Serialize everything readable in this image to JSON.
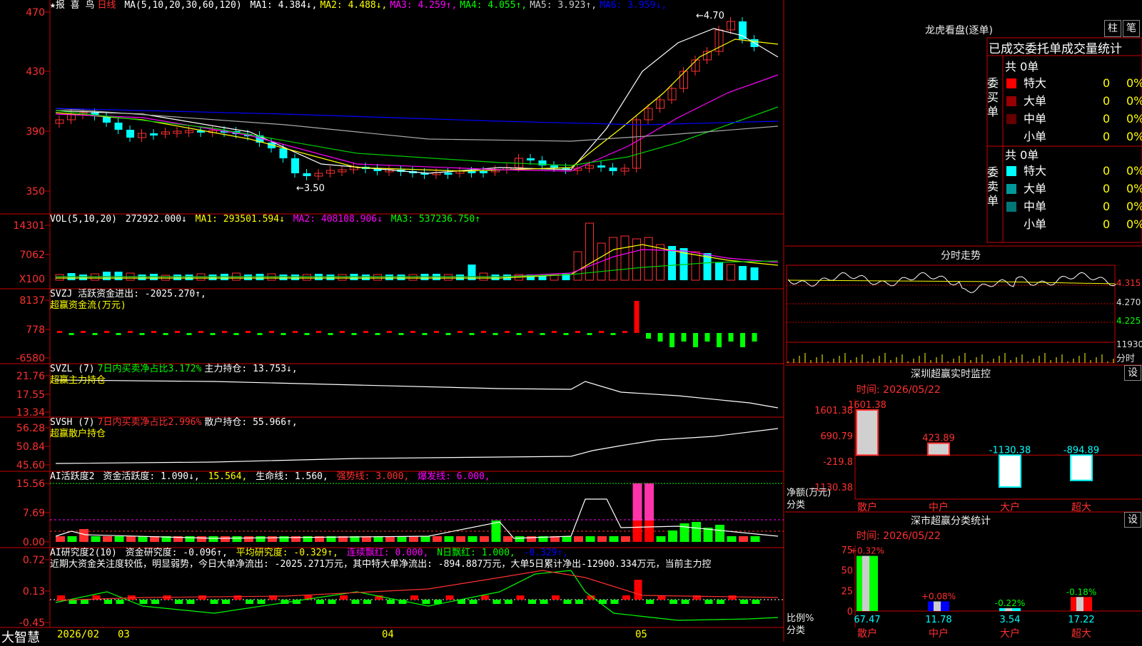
{
  "kline": {
    "title_star": "★报 喜 鸟",
    "period": "日线",
    "ma_params": "MA(5,10,20,30,60,120)",
    "ma": [
      {
        "label": "MA1:",
        "value": "4.384↓",
        "color": "#ffffff"
      },
      {
        "label": "MA2:",
        "value": "4.488↓",
        "color": "#ffff00"
      },
      {
        "label": "MA3:",
        "value": "4.259↑",
        "color": "#ff00ff"
      },
      {
        "label": "MA4:",
        "value": "4.055↑",
        "color": "#00ff00"
      },
      {
        "label": "MA5:",
        "value": "3.923↑",
        "color": "#cccccc"
      },
      {
        "label": "MA6:",
        "value": "3.959↓",
        "color": "#0000ff"
      }
    ],
    "high_marker": "4.70",
    "low_marker": "3.50",
    "y_ticks": [
      "470",
      "430",
      "390",
      "350"
    ]
  },
  "volume": {
    "header_params": "VOL(5,10,20)",
    "value": "272922.000↓",
    "ma1": "MA1: 293501.594↓",
    "ma2": "MA2: 408108.906↓",
    "ma3": "MA3: 537236.750↑",
    "y_ticks": [
      "14301",
      "7062",
      "X100"
    ]
  },
  "svzj": {
    "header": "SVZJ  活跃资金进出: -2025.270↑,",
    "sub": "超赢资金流(万元)",
    "y_ticks": [
      "8137",
      "778",
      "-6580"
    ]
  },
  "svzl": {
    "name": "SVZL (7)",
    "ratio": "7日内买卖净占比3.172%",
    "hold": "主力持仓: 13.753↓,",
    "sub": "超赢主力持仓",
    "y_ticks": [
      "21.76",
      "17.55",
      "13.34"
    ]
  },
  "svsh": {
    "name": "SVSH (7)",
    "ratio": "7日内买卖净占比2.996%",
    "hold": "散户持仓: 55.966↑,",
    "sub": "超赢散户持仓",
    "y_ticks": [
      "56.28",
      "50.84",
      "45.60"
    ]
  },
  "ai_active": {
    "name": "AI活跃度2",
    "v1": "资金活跃度: 1.090↓,",
    "v2": "15.564,",
    "v3": "生命线: 1.560,",
    "v4": "强势线: 3.000,",
    "v5": "爆发线: 6.000,",
    "y_ticks": [
      "15.56",
      "7.69",
      "0.00"
    ]
  },
  "ai_research": {
    "name": "AI研究度2(10)",
    "v1": "资金研究度: -0.096↑,",
    "v2": "平均研究度: -0.329↑,",
    "v3": "连续飘红: 0.000,",
    "v4": "N日飘红: 1.000,",
    "v5": "-0.329↑,",
    "note": "近期大资金关注度较低，明显弱势，今日大单净流出: -2025.271万元，其中特大单净流出: -894.887万元，大单5日累计净出-12900.334万元，当前主力控",
    "y_ticks": [
      "0.72",
      "0.13",
      "-0.45"
    ]
  },
  "bottom_bar": {
    "logo": "大智慧",
    "dates": [
      "2026/02",
      "03",
      "04",
      "05"
    ]
  },
  "lhb": {
    "title": "龙虎看盘(逐单)",
    "btn1": "柱",
    "btn2": "笔",
    "subtitle": "已成交委托单成交量统计",
    "buy_label": "委买单",
    "sell_label": "委卖单",
    "buy_total": "共 0单",
    "sell_total": "共 0单",
    "buy_rows": [
      {
        "name": "特大",
        "count": "0",
        "pct": "0%",
        "color": "#ff0000"
      },
      {
        "name": "大单",
        "count": "0",
        "pct": "0%",
        "color": "#990000"
      },
      {
        "name": "中单",
        "count": "0",
        "pct": "0%",
        "color": "#660000"
      },
      {
        "name": "小单",
        "count": "0",
        "pct": "0%",
        "color": "#000000"
      }
    ],
    "sell_rows": [
      {
        "name": "特大",
        "count": "0",
        "pct": "0%",
        "color": "#00ffff"
      },
      {
        "name": "大单",
        "count": "0",
        "pct": "0%",
        "color": "#009999"
      },
      {
        "name": "中单",
        "count": "0",
        "pct": "0%",
        "color": "#007777"
      },
      {
        "name": "小单",
        "count": "0",
        "pct": "0%",
        "color": "#000000"
      }
    ]
  },
  "intraday": {
    "title": "分时走势",
    "y_ticks": [
      "4.315",
      "4.270",
      "4.225",
      "11930"
    ],
    "fenshi": "分时"
  },
  "sz_monitor": {
    "title": "深圳超赢实时监控",
    "set_btn": "设",
    "time": "时间: 2026/05/22",
    "y_ticks": [
      "1601.38",
      "690.79",
      "-219.8",
      "-1130.38"
    ],
    "ylabel_top": "净额(万元)",
    "ylabel_bottom": "分类",
    "chart_data": {
      "type": "bar",
      "categories": [
        "散户",
        "中户",
        "大户",
        "超大"
      ],
      "values": [
        1601.38,
        423.89,
        -1130.38,
        -894.89
      ],
      "labels": [
        "1601.38",
        "423.89",
        "-1130.38",
        "-894.89"
      ],
      "ylim": [
        -1130.38,
        1601.38
      ]
    }
  },
  "sz_class": {
    "title": "深市超赢分类统计",
    "set_btn": "设",
    "time": "时间: 2026/05/22",
    "y_ticks": [
      "75",
      "50",
      "25",
      "0"
    ],
    "ylabel_top": "比例%",
    "ylabel_bottom": "分类",
    "chart_data": {
      "type": "bar",
      "categories": [
        "散户",
        "中户",
        "大户",
        "超大"
      ],
      "values": [
        67.47,
        11.78,
        3.54,
        17.22
      ],
      "changes": [
        "+0.32%",
        "+0.08%",
        "-0.22%",
        "-0.18%"
      ],
      "ylim": [
        0,
        75
      ]
    }
  }
}
